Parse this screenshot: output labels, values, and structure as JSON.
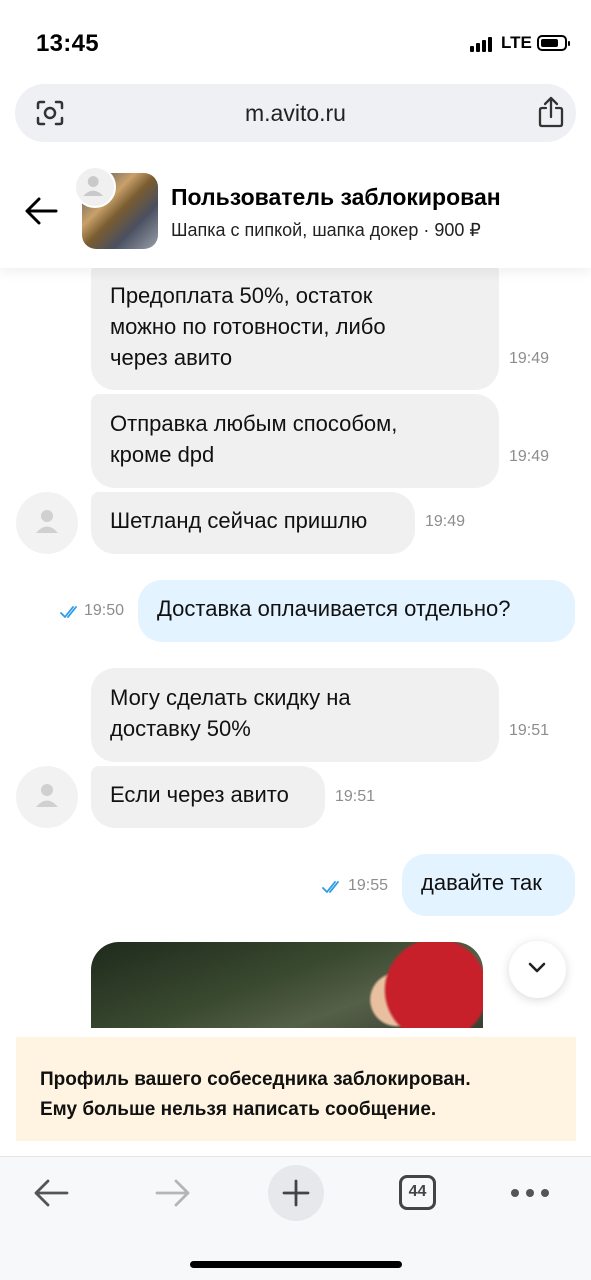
{
  "status_bar": {
    "time": "13:45",
    "network": "LTE"
  },
  "browser": {
    "url": "m.avito.ru",
    "tab_count": "44"
  },
  "chat_header": {
    "title": "Пользователь заблокирован",
    "subtitle": "Шапка с пипкой, шапка докер · 900 ₽"
  },
  "messages": [
    {
      "direction": "in",
      "text": "Предоплата 50%, остаток\nможно по готовности, либо\nчерез авито",
      "time": "19:49"
    },
    {
      "direction": "in",
      "text": "Отправка любым способом,\nкроме dpd",
      "time": "19:49"
    },
    {
      "direction": "in",
      "text": "Шетланд сейчас пришлю",
      "time": "19:49"
    },
    {
      "direction": "out",
      "text": "Доставка оплачивается отдельно?",
      "time": "19:50"
    },
    {
      "direction": "in",
      "text": "Могу сделать скидку на\nдоставку 50%",
      "time": "19:51"
    },
    {
      "direction": "in",
      "text": "Если через авито",
      "time": "19:51"
    },
    {
      "direction": "out",
      "text": "давайте так",
      "time": "19:55"
    }
  ],
  "blocked_notice": {
    "line1": "Профиль вашего собеседника заблокирован.",
    "line2": "Ему больше нельзя написать сообщение."
  },
  "colors": {
    "incoming_bubble": "#f0f0f0",
    "outgoing_bubble": "#e3f3ff",
    "read_ticks": "#2b9be8",
    "blocked_banner": "#fff4e2"
  },
  "icons": [
    "lens-icon",
    "share-icon",
    "back-arrow-icon",
    "avatar-placeholder-icon",
    "double-check-icon",
    "chevron-down-icon",
    "nav-back-icon",
    "nav-forward-icon",
    "plus-icon",
    "tabs-icon",
    "more-icon"
  ]
}
